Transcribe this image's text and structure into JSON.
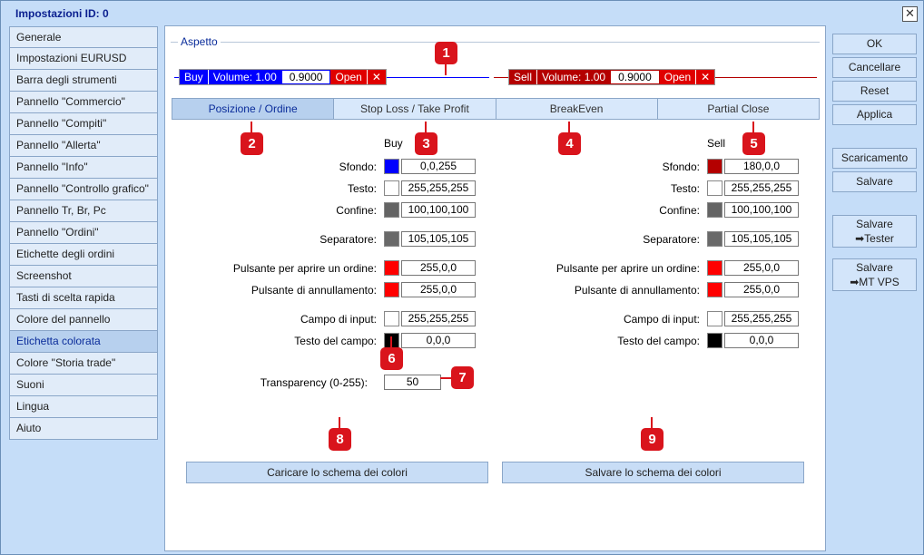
{
  "window": {
    "title": "Impostazioni   ID: 0",
    "close_icon": "close-icon"
  },
  "sidebar": {
    "items": [
      {
        "label": "Generale"
      },
      {
        "label": "Impostazioni EURUSD"
      },
      {
        "label": "Barra degli strumenti"
      },
      {
        "label": "Pannello \"Commercio\""
      },
      {
        "label": "Pannello \"Compiti\""
      },
      {
        "label": "Pannello \"Allerta\""
      },
      {
        "label": "Pannello \"Info\""
      },
      {
        "label": "Pannello \"Controllo grafico\""
      },
      {
        "label": "Pannello Tr, Br, Pc"
      },
      {
        "label": "Pannello \"Ordini\""
      },
      {
        "label": "Etichette degli ordini"
      },
      {
        "label": "Screenshot"
      },
      {
        "label": "Tasti di scelta rapida"
      },
      {
        "label": "Colore del pannello"
      },
      {
        "label": "Etichetta colorata",
        "active": true
      },
      {
        "label": "Colore \"Storia trade\""
      },
      {
        "label": "Suoni"
      },
      {
        "label": "Lingua"
      },
      {
        "label": "Aiuto"
      }
    ]
  },
  "main": {
    "section": "Aspetto",
    "preview": {
      "buy": {
        "side": "Buy",
        "volume": "Volume: 1.00",
        "price": "0.9000",
        "open": "Open",
        "x": "✕"
      },
      "sell": {
        "side": "Sell",
        "volume": "Volume: 1.00",
        "price": "0.9000",
        "open": "Open",
        "x": "✕"
      }
    },
    "tabs": [
      "Posizione / Ordine",
      "Stop Loss / Take Profit",
      "BreakEven",
      "Partial Close"
    ],
    "buy_header": "Buy",
    "sell_header": "Sell",
    "labels": {
      "sfondo": "Sfondo:",
      "testo": "Testo:",
      "confine": "Confine:",
      "separatore": "Separatore:",
      "pulsante_apri": "Pulsante per aprire un ordine:",
      "pulsante_ann": "Pulsante di annullamento:",
      "campo": "Campo di input:",
      "testo_campo": "Testo del campo:"
    },
    "buy": {
      "sfondo": "0,0,255",
      "testo": "255,255,255",
      "confine": "100,100,100",
      "separatore": "105,105,105",
      "pulsante_apri": "255,0,0",
      "pulsante_ann": "255,0,0",
      "campo": "255,255,255",
      "testo_campo": "0,0,0"
    },
    "sell": {
      "sfondo": "180,0,0",
      "testo": "255,255,255",
      "confine": "100,100,100",
      "separatore": "105,105,105",
      "pulsante_apri": "255,0,0",
      "pulsante_ann": "255,0,0",
      "campo": "255,255,255",
      "testo_campo": "0,0,0"
    },
    "transparency_label": "Transparency (0-255):",
    "transparency_value": "50",
    "load_scheme": "Caricare lo schema dei colori",
    "save_scheme": "Salvare lo schema dei colori"
  },
  "badges": [
    "1",
    "2",
    "3",
    "4",
    "5",
    "6",
    "7",
    "8",
    "9"
  ],
  "right": {
    "ok": "OK",
    "cancel": "Cancellare",
    "reset": "Reset",
    "apply": "Applica",
    "download": "Scaricamento",
    "save": "Salvare",
    "save_tester_1": "Salvare",
    "save_tester_2": "➡Tester",
    "save_vps_1": "Salvare",
    "save_vps_2": "➡MT VPS"
  },
  "colors": {
    "buy_blue": "#0000ff",
    "sell_red": "#b40000",
    "badge_red": "#d9141c"
  }
}
